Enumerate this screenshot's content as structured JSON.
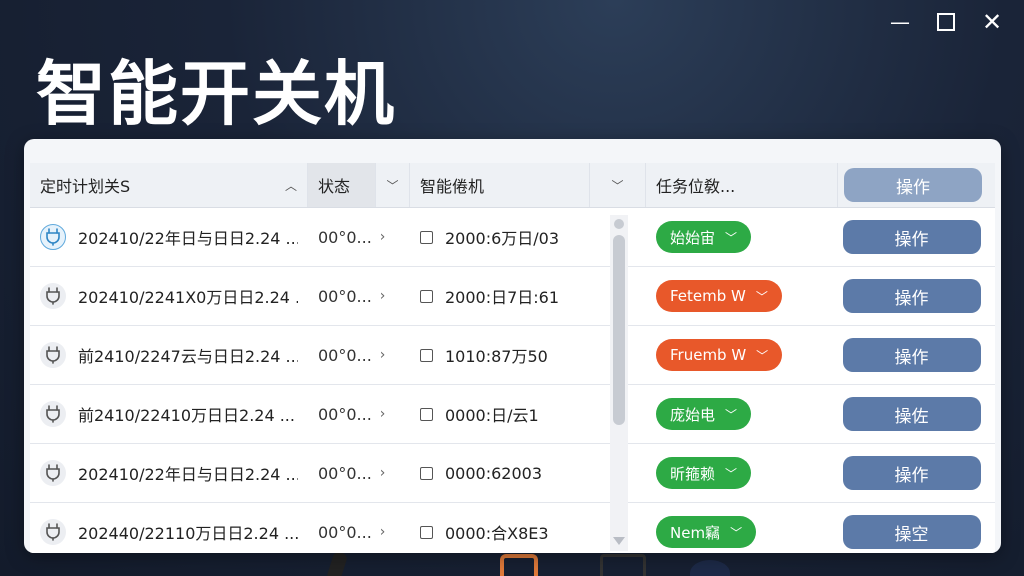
{
  "app": {
    "title": "智能开关机"
  },
  "window": {
    "minimize": "—",
    "close": "✕"
  },
  "table": {
    "headers": {
      "schedule": "定时计划关S",
      "status": "状态",
      "smart": "智能倦机",
      "task": "任务位敎...",
      "operate": "操作"
    },
    "rows": [
      {
        "schedule": "202410/22年日与日日2.24 ...",
        "status": "00°0...",
        "smart": "2000:6万日/03",
        "task": "始始宙",
        "task_color": "green",
        "op": "操作",
        "icon": "power-plug-active-icon"
      },
      {
        "schedule": "202410/2241X0万日日2.24 ...",
        "status": "00°0...",
        "smart": "2000:日7日:61",
        "task": "Fetemb W",
        "task_color": "orange",
        "op": "操作",
        "icon": "power-plug-icon"
      },
      {
        "schedule": "前2410/2247云与日日2.24 ...",
        "status": "00°0...",
        "smart": "1010:87万50",
        "task": "Fruemb W",
        "task_color": "orange",
        "op": "操作",
        "icon": "power-plug-icon"
      },
      {
        "schedule": "前2410/22410万日日2.24 ...",
        "status": "00°0...",
        "smart": "0000:日/云1",
        "task": "庞始电",
        "task_color": "green",
        "op": "操佐",
        "icon": "power-plug-icon"
      },
      {
        "schedule": "202410/22年日与日日2.24 ...",
        "status": "00°0...",
        "smart": "0000:62003",
        "task": "昕箍赖",
        "task_color": "green",
        "op": "操作",
        "icon": "power-plug-icon"
      },
      {
        "schedule": "202440/22110万日日2.24 ...",
        "status": "00°0...",
        "smart": "0000:合X8E3",
        "task": "Nem竊",
        "task_color": "green",
        "op": "操空",
        "icon": "power-plug-icon"
      }
    ]
  },
  "colors": {
    "green": "#2daa45",
    "orange": "#e8582a",
    "button": "#5c7aa8"
  }
}
